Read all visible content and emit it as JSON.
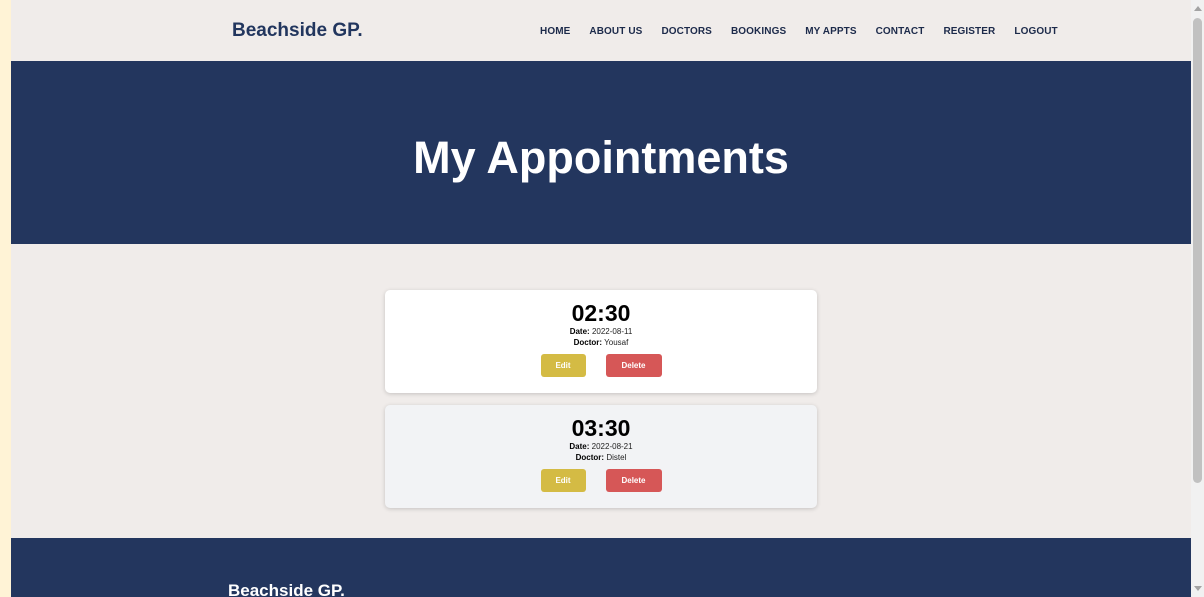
{
  "navbar": {
    "brand": "Beachside GP.",
    "links": [
      "HOME",
      "ABOUT US",
      "DOCTORS",
      "BOOKINGS",
      "MY APPTS",
      "CONTACT",
      "REGISTER",
      "LOGOUT"
    ]
  },
  "hero": {
    "title": "My Appointments"
  },
  "appointments": [
    {
      "time": "02:30",
      "date_label": "Date:",
      "date": "2022-08-11",
      "doctor_label": "Doctor:",
      "doctor": "Yousaf",
      "edit_label": "Edit",
      "delete_label": "Delete"
    },
    {
      "time": "03:30",
      "date_label": "Date:",
      "date": "2022-08-21",
      "doctor_label": "Doctor:",
      "doctor": "Distel",
      "edit_label": "Edit",
      "delete_label": "Delete"
    }
  ],
  "footer": {
    "brand": "Beachside GP."
  },
  "colors": {
    "navy": "#23365e",
    "edit": "#d4bb44",
    "delete": "#d65757",
    "background": "#f0ecea"
  }
}
